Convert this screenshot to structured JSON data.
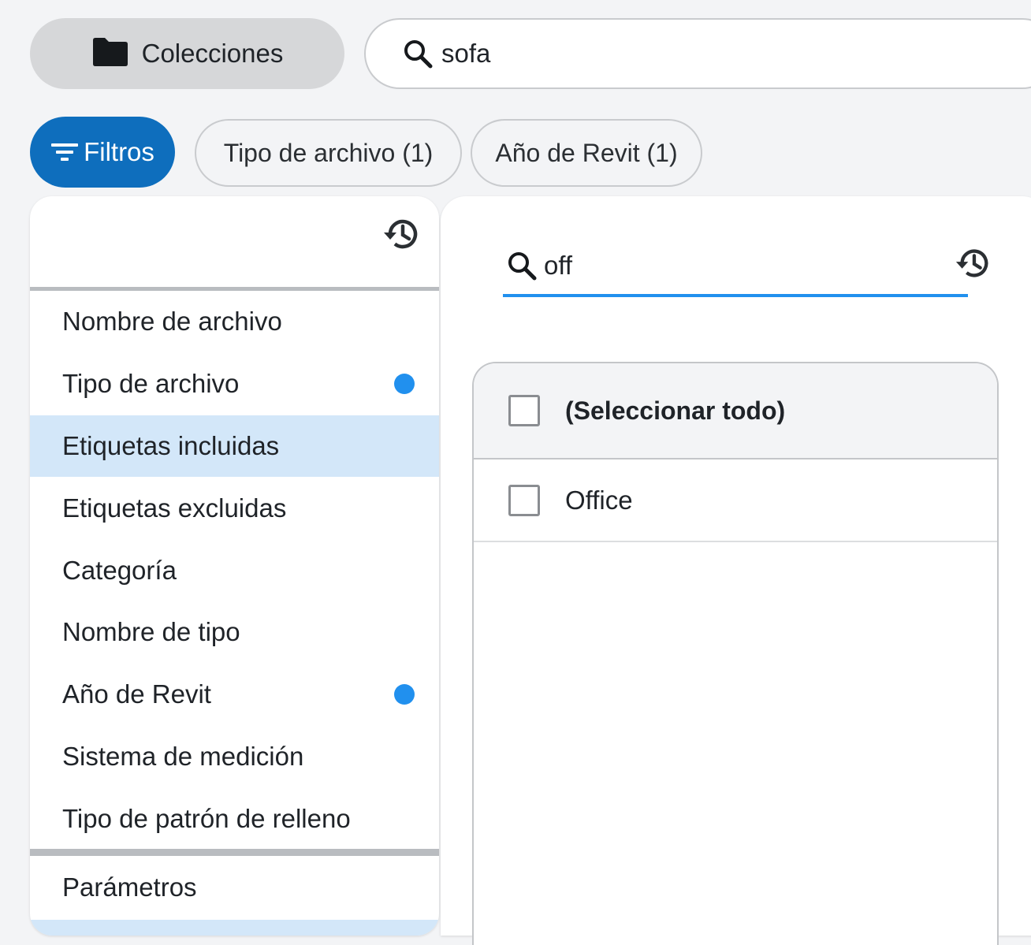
{
  "top_bar": {
    "collections_label": "Colecciones",
    "search_value": "sofa"
  },
  "filter_bar": {
    "filters_label": "Filtros",
    "chips": [
      {
        "label": "Tipo de archivo (1)"
      },
      {
        "label": "Año de Revit (1)"
      }
    ]
  },
  "filter_menu": {
    "items": [
      {
        "label": "Nombre de archivo",
        "active_indicator": false,
        "selected": false
      },
      {
        "label": "Tipo de archivo",
        "active_indicator": true,
        "selected": false
      },
      {
        "label": "Etiquetas incluidas",
        "active_indicator": false,
        "selected": true
      },
      {
        "label": "Etiquetas excluidas",
        "active_indicator": false,
        "selected": false
      },
      {
        "label": "Categoría",
        "active_indicator": false,
        "selected": false
      },
      {
        "label": "Nombre de tipo",
        "active_indicator": false,
        "selected": false
      },
      {
        "label": "Año de Revit",
        "active_indicator": true,
        "selected": false
      },
      {
        "label": "Sistema de medición",
        "active_indicator": false,
        "selected": false
      },
      {
        "label": "Tipo de patrón de relleno",
        "active_indicator": false,
        "selected": false
      }
    ],
    "params_label": "Parámetros"
  },
  "values_panel": {
    "search_value": "off",
    "select_all_label": "(Seleccionar todo)",
    "select_all_checked": false,
    "options": [
      {
        "label": "Office",
        "checked": false
      }
    ]
  },
  "colors": {
    "accent": "#0e6ebd",
    "indicator_dot": "#2190ee",
    "selected_row": "#d3e7f9",
    "background": "#f3f4f6"
  },
  "icons": {
    "collections": "folder-icon",
    "search": "search-icon",
    "filters": "filter-lines-icon",
    "history": "history-icon"
  }
}
